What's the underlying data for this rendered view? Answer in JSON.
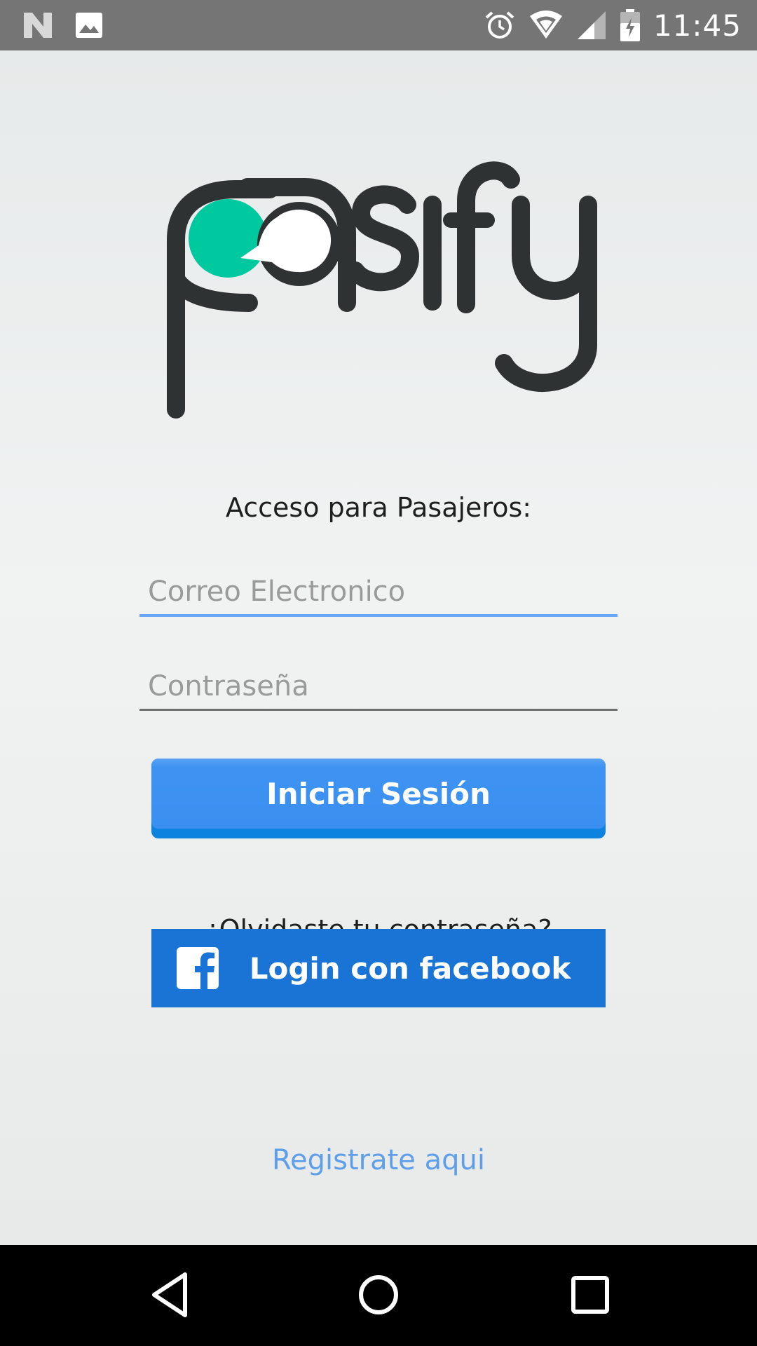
{
  "status_bar": {
    "time": "11:45",
    "left_icons": [
      "n-logo-icon",
      "image-icon"
    ],
    "right_icons": [
      "alarm-icon",
      "wifi-icon",
      "signal-icon",
      "battery-charging-icon"
    ]
  },
  "logo": {
    "text": "pasify",
    "colors": {
      "dark": "#2f3232",
      "accent": "#00c89f"
    }
  },
  "login": {
    "title": "Acceso para Pasajeros:",
    "email_placeholder": "Correo Electronico",
    "password_placeholder": "Contraseña",
    "submit_label": "Iniciar Sesión",
    "forgot_label": "¿Olvidaste tu contraseña?",
    "facebook_label": "Login con facebook",
    "register_label": "Registrate aqui"
  },
  "colors": {
    "primary_button": "#3a8ff0",
    "facebook_button": "#1a74d6",
    "link": "#5f9ee8",
    "active_underline": "#6ba6f4"
  },
  "nav_bar": {
    "buttons": [
      "back-icon",
      "home-icon",
      "recents-icon"
    ]
  }
}
